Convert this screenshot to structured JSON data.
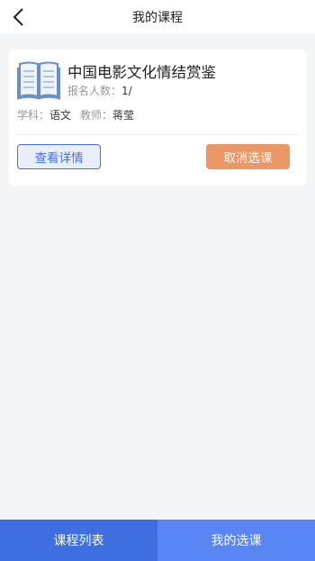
{
  "header": {
    "title": "我的课程",
    "back_icon": "chevron-left-icon"
  },
  "course": {
    "icon": "book-icon",
    "title": "中国电影文化情结赏鉴",
    "enroll_label": "报名人数：",
    "enroll_value": "1/",
    "subject_label": "学科：",
    "subject_value": "语文",
    "teacher_label": "教师：",
    "teacher_value": "蒋莹",
    "detail_button": "查看详情",
    "cancel_button": "取消选课"
  },
  "tabs": [
    {
      "label": "课程列表",
      "active": false
    },
    {
      "label": "我的选课",
      "active": true
    }
  ],
  "colors": {
    "primary": "#3e6ee0",
    "primary_light": "#5a86f5",
    "cancel": "#ec9766",
    "background": "#f4f5f7"
  }
}
